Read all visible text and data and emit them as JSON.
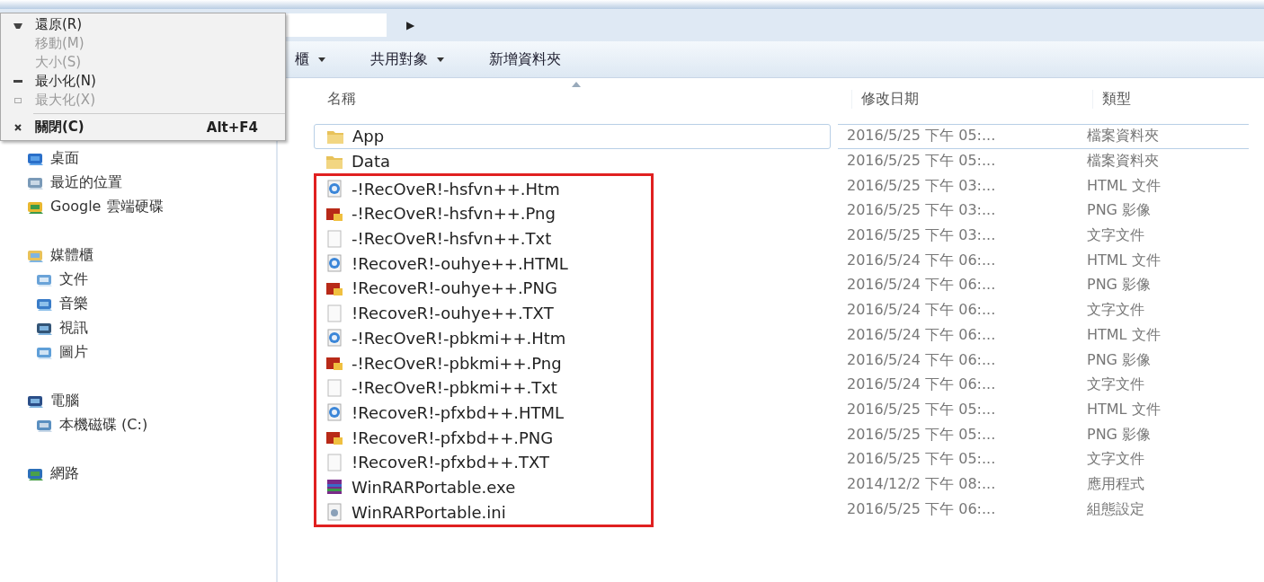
{
  "address_bar": {
    "separator": "▶"
  },
  "toolbar": [
    {
      "label": "櫃",
      "dropdown": true
    },
    {
      "label": "共用對象",
      "dropdown": true
    },
    {
      "label": "新增資料夾",
      "dropdown": false
    }
  ],
  "window_menu": [
    {
      "kind": "restore",
      "label": "還原(R)",
      "disabled": false
    },
    {
      "kind": "plain",
      "label": "移動(M)",
      "disabled": true
    },
    {
      "kind": "plain",
      "label": "大小(S)",
      "disabled": true
    },
    {
      "kind": "minimize",
      "label": "最小化(N)",
      "disabled": false
    },
    {
      "kind": "maximize",
      "label": "最大化(X)",
      "disabled": true
    },
    {
      "kind": "close",
      "label": "關閉(C)",
      "shortcut": "Alt+F4",
      "disabled": false
    }
  ],
  "sidebar": {
    "groups": [
      {
        "items": [
          {
            "kind": "desktop",
            "label": "桌面",
            "indent": false
          },
          {
            "kind": "recent",
            "label": "最近的位置",
            "indent": false
          },
          {
            "kind": "gdrive",
            "label": "Google 雲端硬碟",
            "indent": false
          }
        ]
      },
      {
        "items": [
          {
            "kind": "library",
            "label": "媒體櫃",
            "indent": false
          },
          {
            "kind": "docs",
            "label": "文件",
            "indent": true
          },
          {
            "kind": "music",
            "label": "音樂",
            "indent": true
          },
          {
            "kind": "video",
            "label": "視訊",
            "indent": true
          },
          {
            "kind": "pictures",
            "label": "圖片",
            "indent": true
          }
        ]
      },
      {
        "items": [
          {
            "kind": "computer",
            "label": "電腦",
            "indent": false
          },
          {
            "kind": "disk",
            "label": "本機磁碟 (C:)",
            "indent": true
          }
        ]
      },
      {
        "items": [
          {
            "kind": "network",
            "label": "網路",
            "indent": false
          }
        ]
      }
    ]
  },
  "table": {
    "columns": [
      "名稱",
      "修改日期",
      "類型"
    ],
    "rows": [
      {
        "kind": "folder",
        "name": "App",
        "date": "2016/5/25 下午 05:...",
        "type": "檔案資料夾",
        "selected": true,
        "highlighted": false
      },
      {
        "kind": "folder",
        "name": "Data",
        "date": "2016/5/25 下午 05:...",
        "type": "檔案資料夾",
        "selected": false,
        "highlighted": false
      },
      {
        "kind": "html",
        "name": "-!RecOveR!-hsfvn++.Htm",
        "date": "2016/5/25 下午 03:...",
        "type": "HTML 文件",
        "selected": false,
        "highlighted": true
      },
      {
        "kind": "png",
        "name": "-!RecOveR!-hsfvn++.Png",
        "date": "2016/5/25 下午 03:...",
        "type": "PNG 影像",
        "selected": false,
        "highlighted": true
      },
      {
        "kind": "txt",
        "name": "-!RecOveR!-hsfvn++.Txt",
        "date": "2016/5/25 下午 03:...",
        "type": "文字文件",
        "selected": false,
        "highlighted": true
      },
      {
        "kind": "html",
        "name": "!RecoveR!-ouhye++.HTML",
        "date": "2016/5/24 下午 06:...",
        "type": "HTML 文件",
        "selected": false,
        "highlighted": true
      },
      {
        "kind": "png",
        "name": "!RecoveR!-ouhye++.PNG",
        "date": "2016/5/24 下午 06:...",
        "type": "PNG 影像",
        "selected": false,
        "highlighted": true
      },
      {
        "kind": "txt",
        "name": "!RecoveR!-ouhye++.TXT",
        "date": "2016/5/24 下午 06:...",
        "type": "文字文件",
        "selected": false,
        "highlighted": true
      },
      {
        "kind": "html",
        "name": "-!RecOveR!-pbkmi++.Htm",
        "date": "2016/5/24 下午 06:...",
        "type": "HTML 文件",
        "selected": false,
        "highlighted": true
      },
      {
        "kind": "png",
        "name": "-!RecOveR!-pbkmi++.Png",
        "date": "2016/5/24 下午 06:...",
        "type": "PNG 影像",
        "selected": false,
        "highlighted": true
      },
      {
        "kind": "txt",
        "name": "-!RecOveR!-pbkmi++.Txt",
        "date": "2016/5/24 下午 06:...",
        "type": "文字文件",
        "selected": false,
        "highlighted": true
      },
      {
        "kind": "html",
        "name": "!RecoveR!-pfxbd++.HTML",
        "date": "2016/5/25 下午 05:...",
        "type": "HTML 文件",
        "selected": false,
        "highlighted": true
      },
      {
        "kind": "png",
        "name": "!RecoveR!-pfxbd++.PNG",
        "date": "2016/5/25 下午 05:...",
        "type": "PNG 影像",
        "selected": false,
        "highlighted": true
      },
      {
        "kind": "txt",
        "name": "!RecoveR!-pfxbd++.TXT",
        "date": "2016/5/25 下午 05:...",
        "type": "文字文件",
        "selected": false,
        "highlighted": true
      },
      {
        "kind": "exe",
        "name": "WinRARPortable.exe",
        "date": "2014/12/2 下午 08:...",
        "type": "應用程式",
        "selected": false,
        "highlighted": true
      },
      {
        "kind": "ini",
        "name": "WinRARPortable.ini",
        "date": "2016/5/25 下午 06:...",
        "type": "組態設定",
        "selected": false,
        "highlighted": true
      }
    ]
  }
}
